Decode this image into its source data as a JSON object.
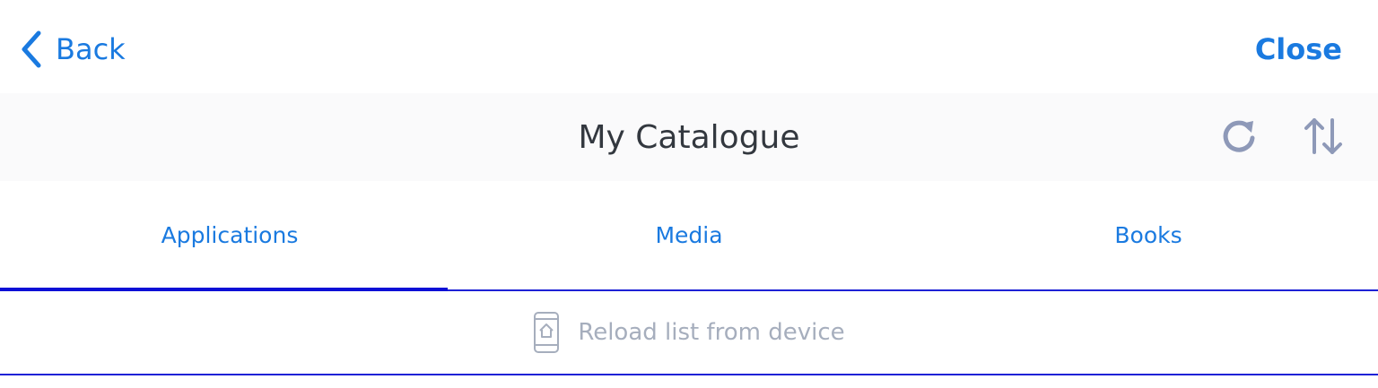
{
  "nav": {
    "back_label": "Back",
    "close_label": "Close"
  },
  "header": {
    "title": "My Catalogue",
    "actions": [
      {
        "icon": "refresh-icon"
      },
      {
        "icon": "sort-icon"
      }
    ]
  },
  "tabs": [
    {
      "label": "Applications",
      "active": true
    },
    {
      "label": "Media",
      "active": false
    },
    {
      "label": "Books",
      "active": false
    }
  ],
  "content": {
    "reload_icon": "device-home-icon",
    "reload_label": "Reload list from device"
  },
  "colors": {
    "accent": "#1a7ae0",
    "tab_indicator": "#0b0fd6",
    "title_text": "#33383f",
    "icon_gray": "#8e99b8",
    "muted_text": "#a6aebd"
  }
}
